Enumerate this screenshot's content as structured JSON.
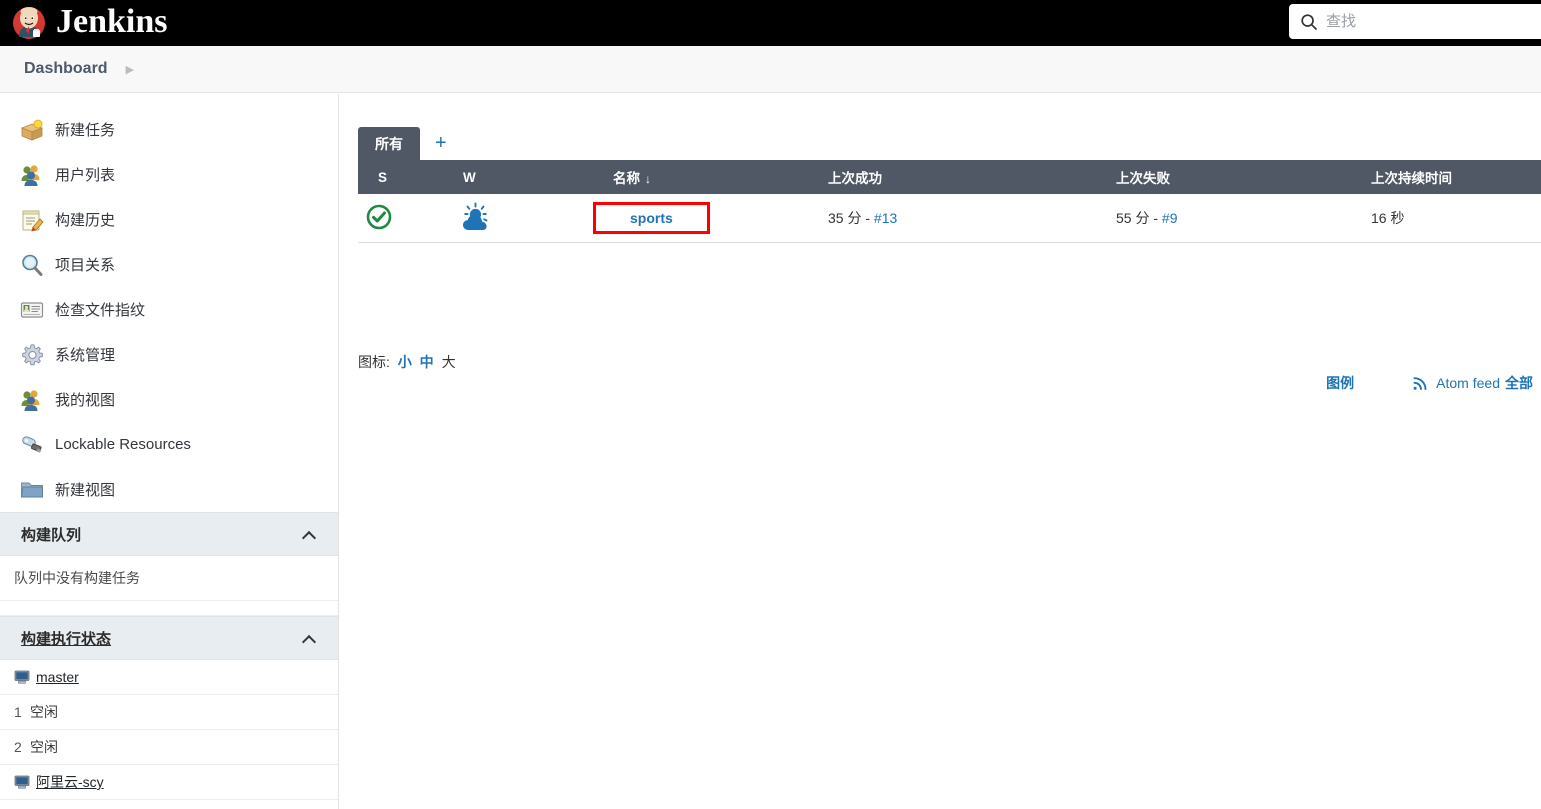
{
  "header": {
    "brand_title": "Jenkins",
    "logo_icon": "jenkins-butler-logo",
    "search": {
      "icon": "search-icon",
      "placeholder": "查找",
      "value": ""
    }
  },
  "breadcrumb": {
    "items": [
      "Dashboard"
    ],
    "separator_icon": "chevron-right-icon"
  },
  "sidebar": {
    "tasks": [
      {
        "label": "新建任务",
        "icon": "new-item-icon"
      },
      {
        "label": "用户列表",
        "icon": "people-icon"
      },
      {
        "label": "构建历史",
        "icon": "build-history-icon"
      },
      {
        "label": "项目关系",
        "icon": "project-relationship-icon"
      },
      {
        "label": "检查文件指纹",
        "icon": "fingerprint-check-icon"
      },
      {
        "label": "系统管理",
        "icon": "gear-icon"
      },
      {
        "label": "我的视图",
        "icon": "my-views-icon"
      },
      {
        "label": "Lockable Resources",
        "icon": "usb-lock-icon"
      },
      {
        "label": "新建视图",
        "icon": "folder-icon"
      }
    ],
    "build_queue": {
      "title": "构建队列",
      "collapse_icon": "chevron-up-icon",
      "empty_text": "队列中没有构建任务"
    },
    "build_executor": {
      "title": "构建执行状态",
      "collapse_icon": "chevron-up-icon",
      "nodes": [
        {
          "type": "node",
          "icon": "computer-icon",
          "label": "master"
        },
        {
          "type": "executor",
          "index": "1",
          "state": "空闲"
        },
        {
          "type": "executor",
          "index": "2",
          "state": "空闲"
        },
        {
          "type": "node",
          "icon": "computer-icon",
          "label": "阿里云-scy"
        }
      ]
    }
  },
  "main": {
    "tabs": {
      "active_label": "所有",
      "add_label": "+",
      "add_icon": "plus-icon"
    },
    "table": {
      "columns": [
        {
          "key": "s",
          "label": "S",
          "sorted": false
        },
        {
          "key": "w",
          "label": "W",
          "sorted": false
        },
        {
          "key": "name",
          "label": "名称",
          "sorted": true,
          "sort_arrow": "↓"
        },
        {
          "key": "last_success",
          "label": "上次成功",
          "sorted": false
        },
        {
          "key": "last_failure",
          "label": "上次失败",
          "sorted": false
        },
        {
          "key": "last_duration",
          "label": "上次持续时间",
          "sorted": false
        }
      ],
      "rows": [
        {
          "status_icon": "status-success-check-icon",
          "status_color": "#1e8a45",
          "weather_icon": "weather-sun-behind-cloud-icon",
          "weather_color": "#1f73b7",
          "name": "sports",
          "name_highlighted": true,
          "last_success_time": "35 分",
          "last_success_sep": "-",
          "last_success_build": "#13",
          "last_failure_time": "55 分",
          "last_failure_sep": "-",
          "last_failure_build": "#9",
          "last_duration": "16 秒"
        }
      ]
    },
    "icon_size": {
      "prefix": "图标:",
      "small": "小",
      "medium": "中",
      "large": "大",
      "current": "大"
    },
    "footer": {
      "legend": "图例",
      "feed_icon": "rss-icon",
      "feed_label": "Atom feed",
      "feed_all": "全部"
    }
  },
  "colors": {
    "header_bg": "#000000",
    "table_header_bg": "#4f5864",
    "link_blue": "#1f73b7",
    "highlight_red": "#ff0000",
    "panel_head_bg": "#e8edf1",
    "success_green": "#1e8a45"
  }
}
